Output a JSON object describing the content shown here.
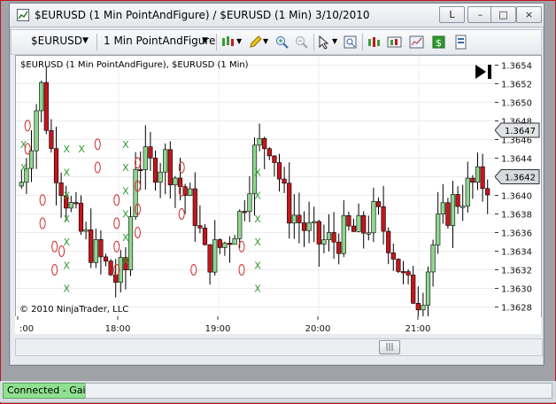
{
  "window": {
    "title": "$EURUSD (1 Min PointAndFigure) / $EURUSD (1 Min)  3/10/2010",
    "buttons": [
      "L",
      "–",
      "□",
      "×"
    ]
  },
  "toolbar": {
    "instrument": "$EURUSD",
    "period": "1 Min PointAndFigure",
    "icons": [
      "bar-style-icon",
      "drawing-pencil-icon",
      "zoom-in-icon",
      "zoom-out-icon",
      "cursor-icon",
      "properties-icon",
      "indicators-icon",
      "strategies-icon",
      "chart-trader-icon",
      "data-box-icon"
    ]
  },
  "chart": {
    "label": "$EURUSD (1 Min PointAndFigure), $EURUSD (1 Min)",
    "copyright": "© 2010 NinjaTrader, LLC",
    "price_ticks": [
      "1.3654",
      "1.3652",
      "1.3650",
      "1.3648",
      "1.3646",
      "1.3644",
      "1.3642",
      "1.3640",
      "1.3638",
      "1.3636",
      "1.3634",
      "1.3632",
      "1.3630",
      "1.3628"
    ],
    "price_markers": [
      "1.3647",
      "1.3642"
    ],
    "time_ticks": [
      ":00",
      "18:00",
      "19:00",
      "20:00",
      "21:00"
    ],
    "colors": {
      "up": "#8fd68f",
      "down": "#c4161c",
      "x_mark": "#2e9a2e",
      "o_mark": "#d12b2b"
    }
  },
  "chart_data": {
    "type": "candlestick",
    "title": "$EURUSD (1 Min PointAndFigure), $EURUSD (1 Min)",
    "x_ticks": [
      ":00",
      "18:00",
      "19:00",
      "20:00",
      "21:00"
    ],
    "ylim": [
      1.3627,
      1.3655
    ],
    "y_ticks": [
      1.3654,
      1.3652,
      1.365,
      1.3648,
      1.3646,
      1.3644,
      1.3642,
      1.364,
      1.3638,
      1.3636,
      1.3634,
      1.3632,
      1.363,
      1.3628
    ],
    "last_price": 1.3642,
    "marked_price": 1.3647,
    "pf_columns": [
      {
        "t": 0.05,
        "kind": "X",
        "from": 1.3643,
        "to": 1.3647
      },
      {
        "t": 0.09,
        "kind": "O",
        "from": 1.3649,
        "to": 1.3645
      },
      {
        "t": 0.24,
        "kind": "O",
        "from": 1.3641,
        "to": 1.3637
      },
      {
        "t": 0.36,
        "kind": "O",
        "from": 1.3636,
        "to": 1.3632
      },
      {
        "t": 0.43,
        "kind": "O",
        "from": 1.3636,
        "to": 1.3634
      },
      {
        "t": 0.48,
        "kind": "X",
        "from": 1.363,
        "to": 1.3646
      },
      {
        "t": 0.63,
        "kind": "X",
        "from": 1.3645,
        "to": 1.3647
      },
      {
        "t": 0.79,
        "kind": "O",
        "from": 1.3646,
        "to": 1.3643
      },
      {
        "t": 0.98,
        "kind": "O",
        "from": 1.364,
        "to": 1.3632
      },
      {
        "t": 1.07,
        "kind": "X",
        "from": 1.3633,
        "to": 1.3646
      },
      {
        "t": 1.19,
        "kind": "O",
        "from": 1.3645,
        "to": 1.3636
      },
      {
        "t": 1.63,
        "kind": "O",
        "from": 1.3645,
        "to": 1.3638
      },
      {
        "t": 1.75,
        "kind": "O",
        "from": 1.3634,
        "to": 1.3632
      },
      {
        "t": 2.23,
        "kind": "O",
        "from": 1.3636,
        "to": 1.3632
      },
      {
        "t": 2.39,
        "kind": "X",
        "from": 1.363,
        "to": 1.3643
      }
    ]
  }
}
